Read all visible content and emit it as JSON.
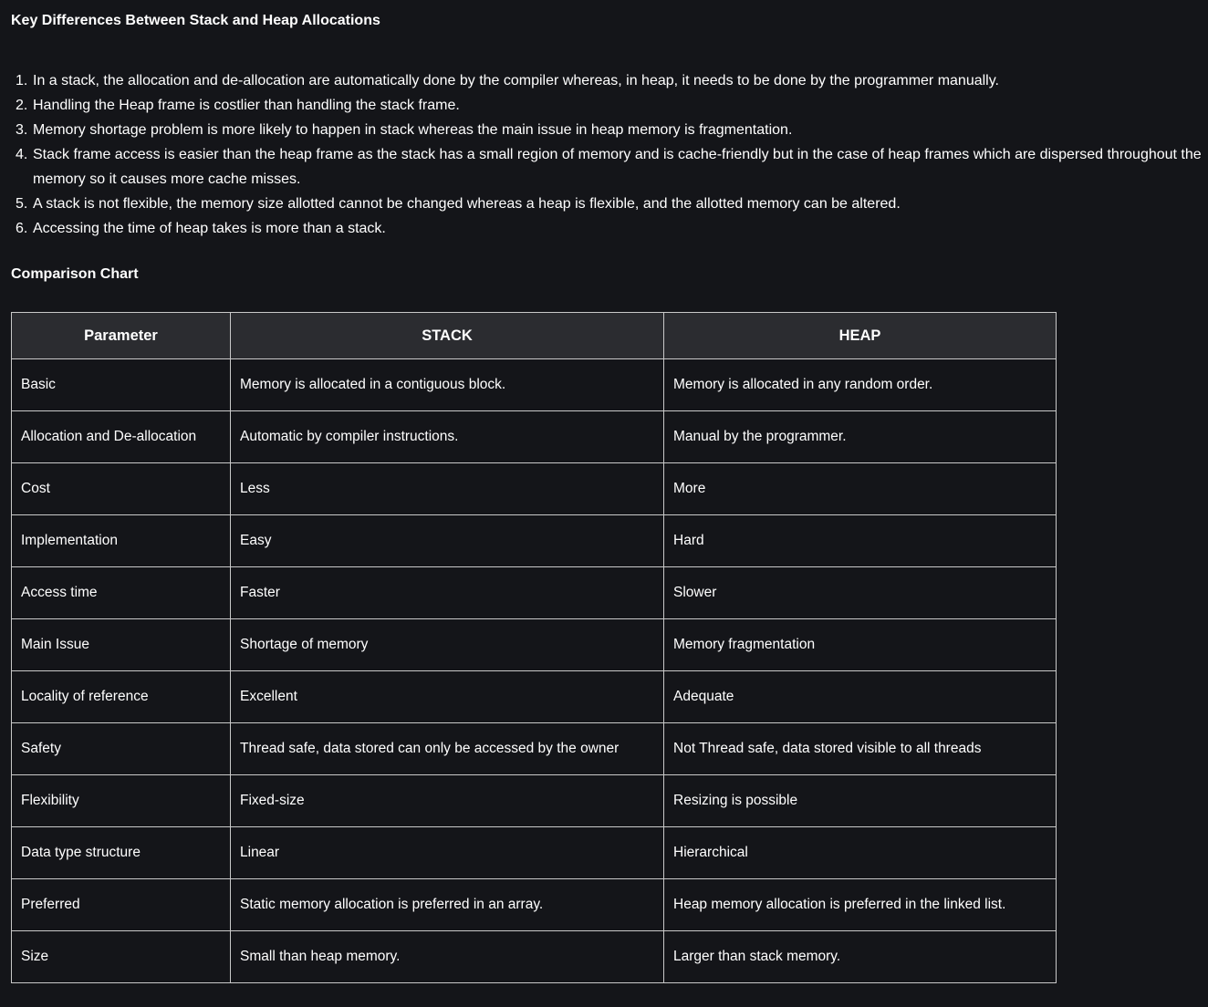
{
  "title": "Key Differences Between Stack and Heap Allocations",
  "differences": [
    "In a stack, the allocation and de-allocation are automatically done by the compiler whereas, in heap, it needs to be done by the programmer manually.",
    "Handling the Heap frame is costlier than handling the stack frame.",
    "Memory shortage problem is more likely to happen in stack whereas the main issue in heap memory is fragmentation.",
    "Stack frame access is easier than the heap frame as the stack has a small region of memory and is cache-friendly but in the case of heap frames which are dispersed throughout the memory so it causes more cache misses.",
    "A stack is not flexible, the memory size allotted cannot be changed whereas a heap is flexible, and the allotted memory can be altered.",
    "Accessing the time of heap takes is more than a stack."
  ],
  "comparison_title": "Comparison Chart",
  "table": {
    "headers": [
      "Parameter",
      "STACK",
      "HEAP"
    ],
    "rows": [
      [
        "Basic",
        "Memory is allocated in a contiguous block.",
        "Memory is allocated in any random order."
      ],
      [
        "Allocation and De-allocation",
        "Automatic by compiler instructions.",
        "Manual by the programmer."
      ],
      [
        "Cost",
        "Less",
        "More"
      ],
      [
        "Implementation",
        "Easy",
        "Hard"
      ],
      [
        "Access time",
        "Faster",
        "Slower"
      ],
      [
        "Main Issue",
        "Shortage of memory",
        "Memory fragmentation"
      ],
      [
        "Locality of reference",
        "Excellent",
        "Adequate"
      ],
      [
        "Safety",
        "Thread safe, data stored can only be accessed by the owner",
        "Not Thread safe, data stored visible to all threads"
      ],
      [
        "Flexibility",
        "Fixed-size",
        "Resizing is possible"
      ],
      [
        "Data type structure",
        "Linear",
        "Hierarchical"
      ],
      [
        "Preferred",
        "Static memory allocation is preferred in an array.",
        "Heap memory allocation is preferred in the linked list."
      ],
      [
        "Size",
        "Small than heap memory.",
        "Larger than stack memory."
      ]
    ]
  },
  "colors": {
    "background": "#141519",
    "header_background": "#2b2c30",
    "border": "#c9c9c9",
    "text": "#ffffff"
  }
}
